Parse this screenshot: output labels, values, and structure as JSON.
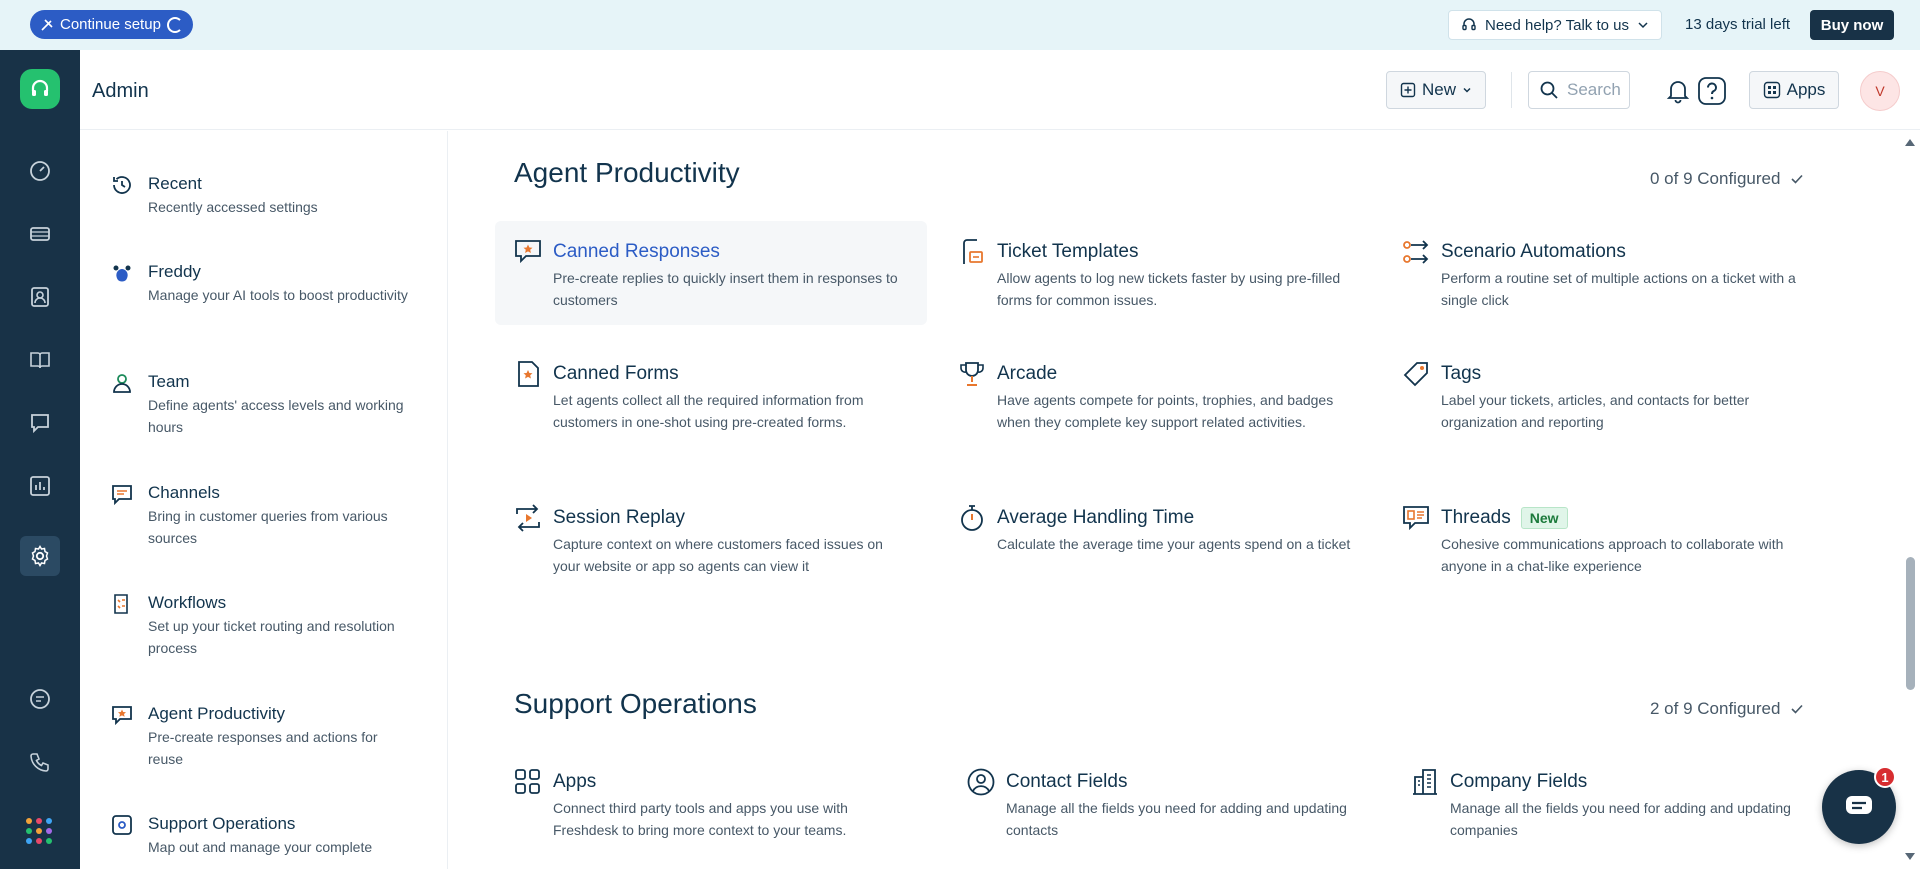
{
  "banner": {
    "setup_label": "Continue setup",
    "help_label": "Need help? Talk to us",
    "trial_text": "13 days trial left",
    "buy_label": "Buy now"
  },
  "header": {
    "title": "Admin",
    "new_label": "New",
    "search_placeholder": "Search",
    "apps_label": "Apps",
    "avatar_initial": "V"
  },
  "sidebar": {
    "items": [
      {
        "title": "Recent",
        "desc": "Recently accessed settings",
        "icon": "history-icon"
      },
      {
        "title": "Freddy",
        "desc": "Manage your AI tools to boost productivity",
        "icon": "freddy-icon"
      },
      {
        "title": "Team",
        "desc": "Define agents' access levels and working hours",
        "icon": "team-icon"
      },
      {
        "title": "Channels",
        "desc": "Bring in customer queries from various sources",
        "icon": "channels-icon"
      },
      {
        "title": "Workflows",
        "desc": "Set up your ticket routing and resolution process",
        "icon": "workflows-icon"
      },
      {
        "title": "Agent Productivity",
        "desc": "Pre-create responses and actions for reuse",
        "icon": "agent-productivity-icon"
      },
      {
        "title": "Support Operations",
        "desc": "Map out and manage your complete",
        "icon": "support-operations-icon"
      }
    ]
  },
  "sections": {
    "agent_productivity": {
      "title": "Agent Productivity",
      "configured": "0 of 9 Configured",
      "cards": [
        {
          "title": "Canned Responses",
          "desc": "Pre-create replies to quickly insert them in responses to customers"
        },
        {
          "title": "Ticket Templates",
          "desc": "Allow agents to log new tickets faster by using pre-filled forms for common issues."
        },
        {
          "title": "Scenario Automations",
          "desc": "Perform a routine set of multiple actions on a ticket with a single click"
        },
        {
          "title": "Canned Forms",
          "desc": "Let agents collect all the required information from customers in one-shot using pre-created forms."
        },
        {
          "title": "Arcade",
          "desc": "Have agents compete for points, trophies, and badges when they complete key support related activities."
        },
        {
          "title": "Tags",
          "desc": "Label your tickets, articles, and contacts for better organization and reporting"
        },
        {
          "title": "Session Replay",
          "desc": "Capture context on where customers faced issues on your website or app so agents can view it"
        },
        {
          "title": "Average Handling Time",
          "desc": "Calculate the average time your agents spend on a ticket"
        },
        {
          "title": "Threads",
          "desc": "Cohesive communications approach to collaborate with anyone in a chat-like experience",
          "badge": "New"
        }
      ]
    },
    "support_operations": {
      "title": "Support Operations",
      "configured": "2 of 9 Configured",
      "cards": [
        {
          "title": "Apps",
          "desc": "Connect third party tools and apps you use with Freshdesk to bring more context to your teams."
        },
        {
          "title": "Contact Fields",
          "desc": "Manage all the fields you need for adding and updating contacts"
        },
        {
          "title": "Company Fields",
          "desc": "Manage all the fields you need for adding and updating companies"
        }
      ]
    }
  },
  "chat": {
    "badge_count": "1"
  },
  "colors": {
    "accent": "#2c5cc5",
    "rail": "#183247",
    "brand_green": "#25c16f",
    "icon_orange": "#e8772e"
  }
}
